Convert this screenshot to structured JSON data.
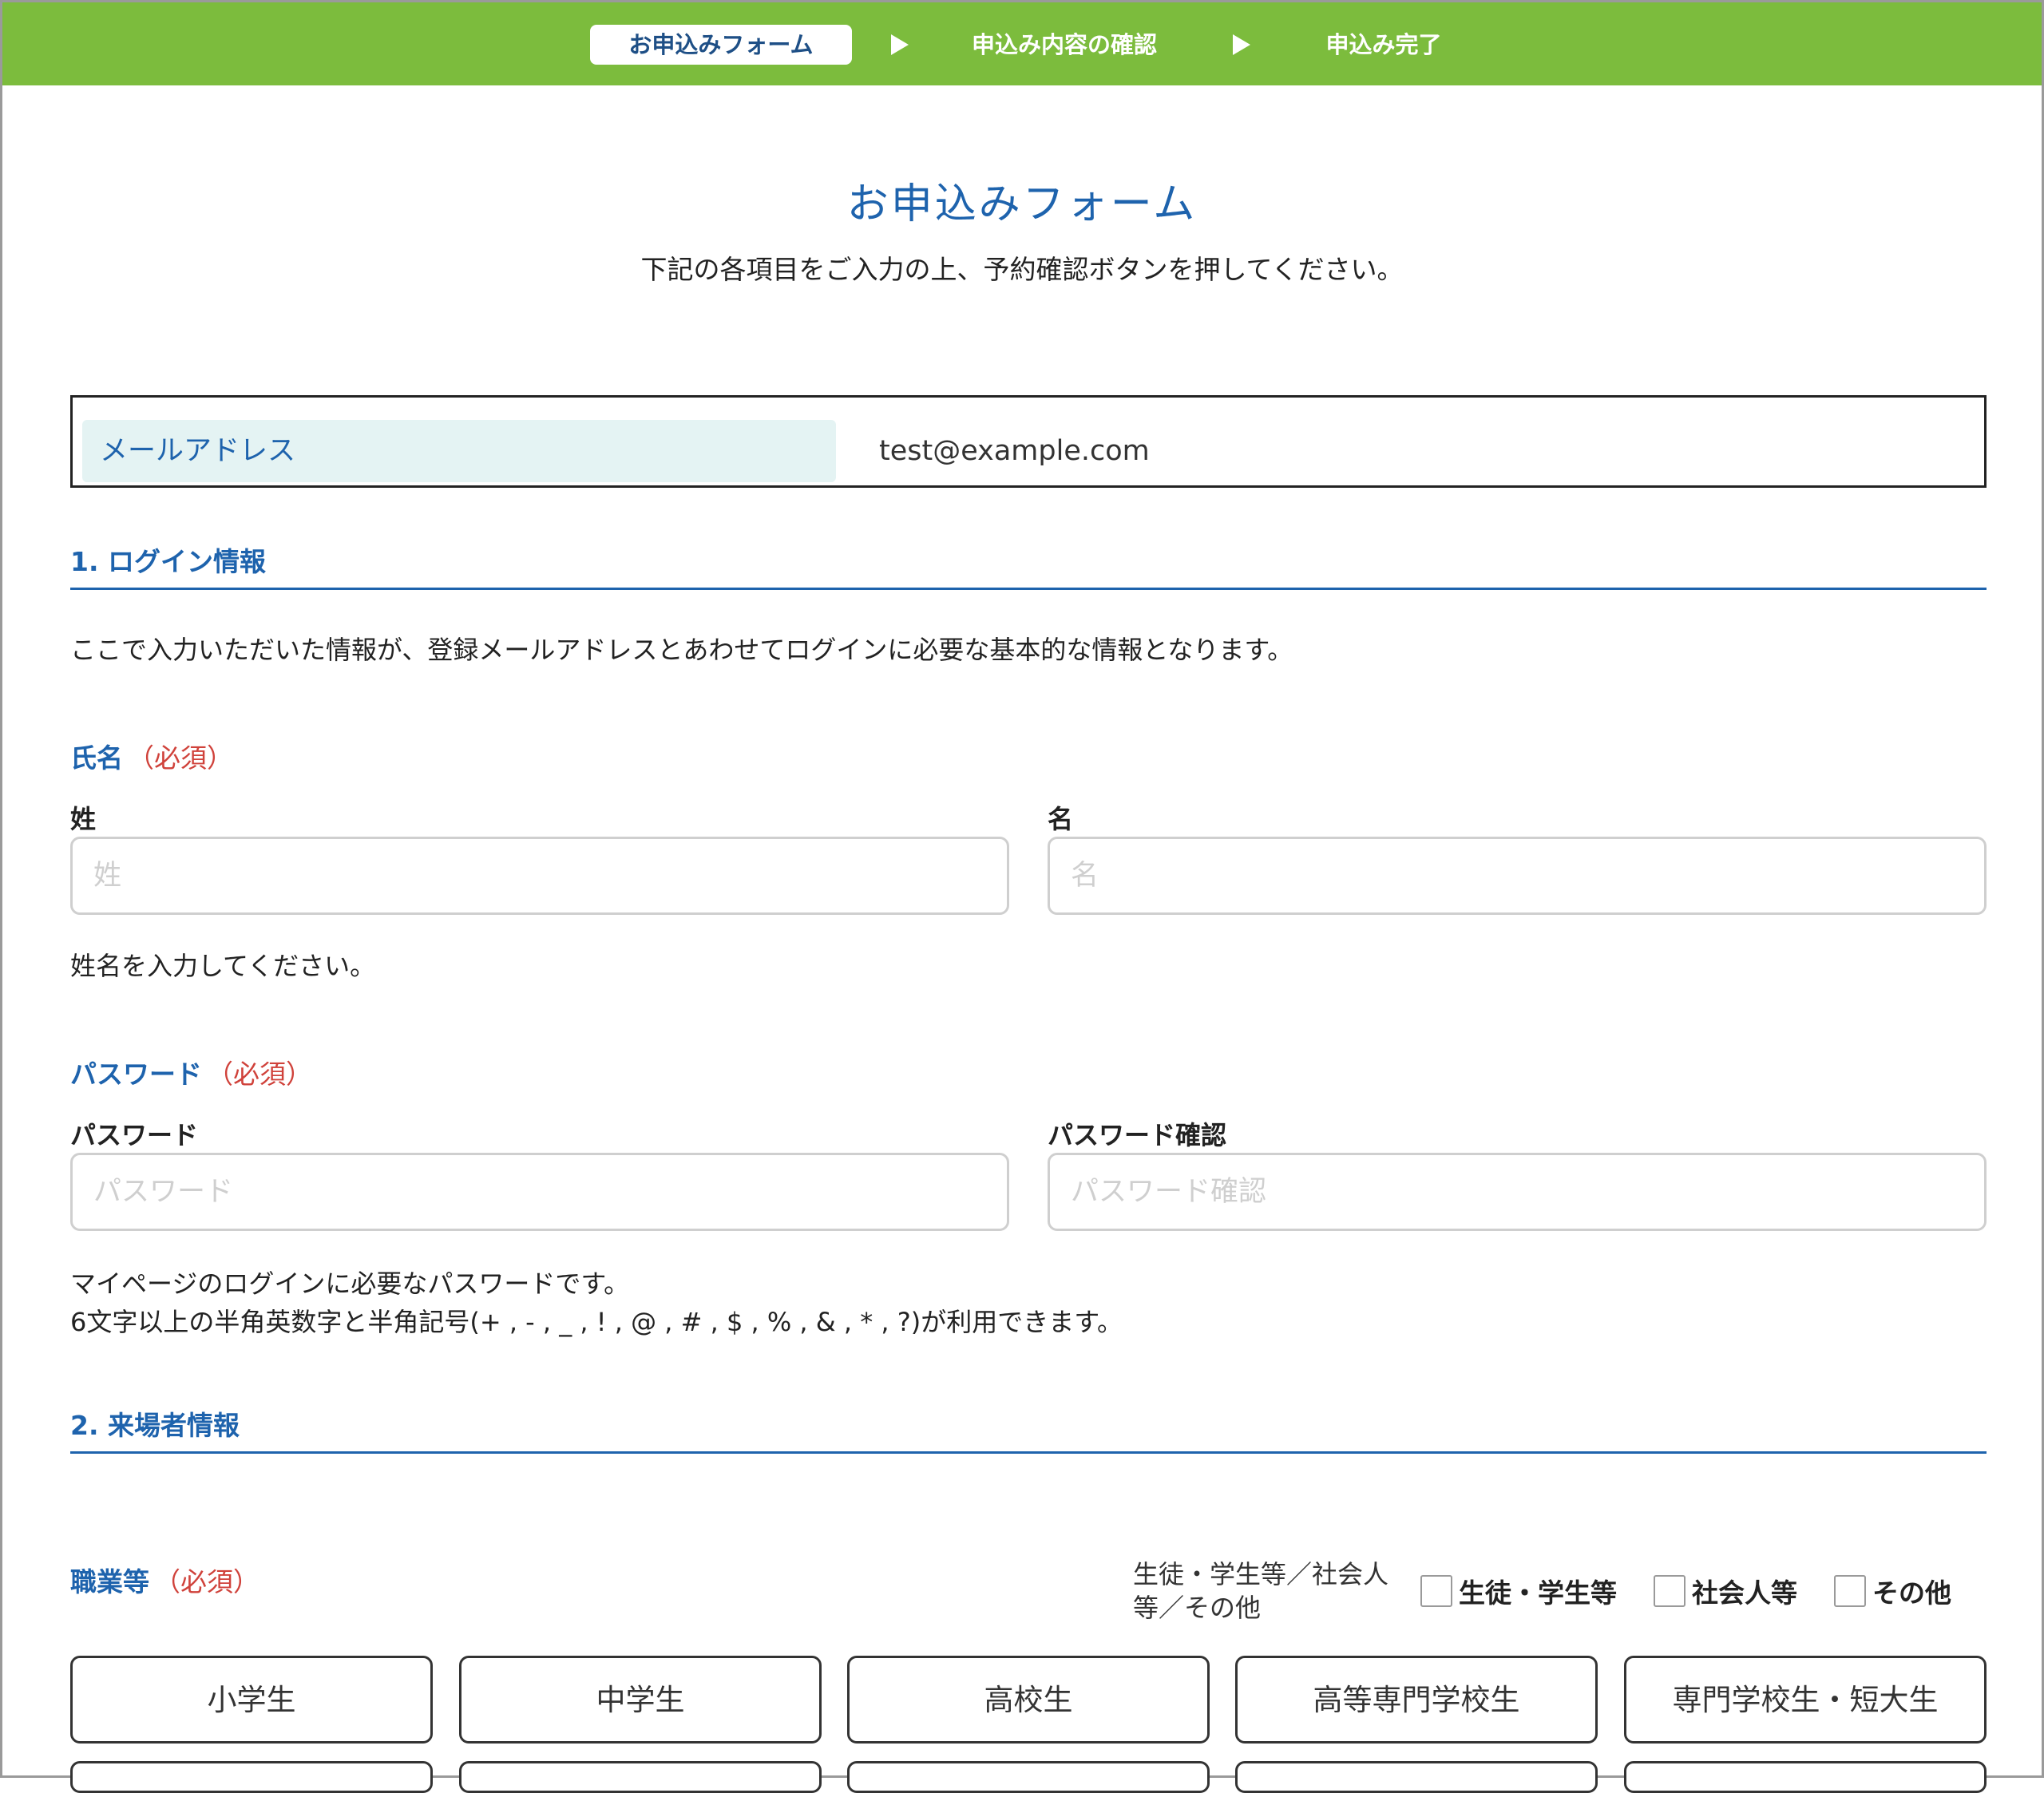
{
  "stepper": {
    "steps": [
      "お申込みフォーム",
      "申込み内容の確認",
      "申込み完了"
    ]
  },
  "header": {
    "title": "お申込みフォーム",
    "subtitle": "下記の各項目をご入力の上、予約確認ボタンを押してください。"
  },
  "email": {
    "label": "メールアドレス",
    "value": "test@example.com"
  },
  "login_section": {
    "heading": "1. ログイン情報",
    "description": "ここで入力いただいた情報が、登録メールアドレスとあわせてログインに必要な基本的な情報となります。"
  },
  "name_field": {
    "label": "氏名",
    "required": "（必須）",
    "last_label": "姓",
    "last_placeholder": "姓",
    "first_label": "名",
    "first_placeholder": "名",
    "help": "姓名を入力してください。"
  },
  "password_field": {
    "label": "パスワード",
    "required": "（必須）",
    "pw_label": "パスワード",
    "pw_placeholder": "パスワード",
    "confirm_label": "パスワード確認",
    "confirm_placeholder": "パスワード確認",
    "help_line1": "マイページのログインに必要なパスワードです。",
    "help_line2": "6文字以上の半角英数字と半角記号(+ , - , _ , ! , @ , # , $ , % , & , * , ?)が利用できます。"
  },
  "visitor_section": {
    "heading": "2. 来場者情報"
  },
  "occupation_field": {
    "label": "職業等",
    "required": "（必須）",
    "filter_label": "生徒・学生等／社会人等／その他",
    "filters": [
      "生徒・学生等",
      "社会人等",
      "その他"
    ],
    "options": [
      "小学生",
      "中学生",
      "高校生",
      "高等専門学校生",
      "専門学校生・短大生"
    ]
  }
}
